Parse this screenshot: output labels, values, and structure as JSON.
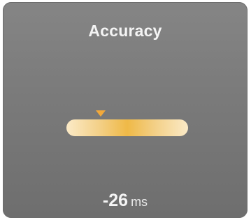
{
  "panel": {
    "title": "Accuracy",
    "offset_value": "-26",
    "offset_unit": "ms",
    "marker_position_fraction": 0.28
  },
  "colors": {
    "panel_top": "#858585",
    "panel_bottom": "#6e6e6e",
    "meter_center": "#efb947",
    "meter_edge": "#fbeac7",
    "marker": "#f2a93a",
    "text": "#f4f4f4"
  },
  "icons": {
    "marker": "triangle-down-icon"
  }
}
